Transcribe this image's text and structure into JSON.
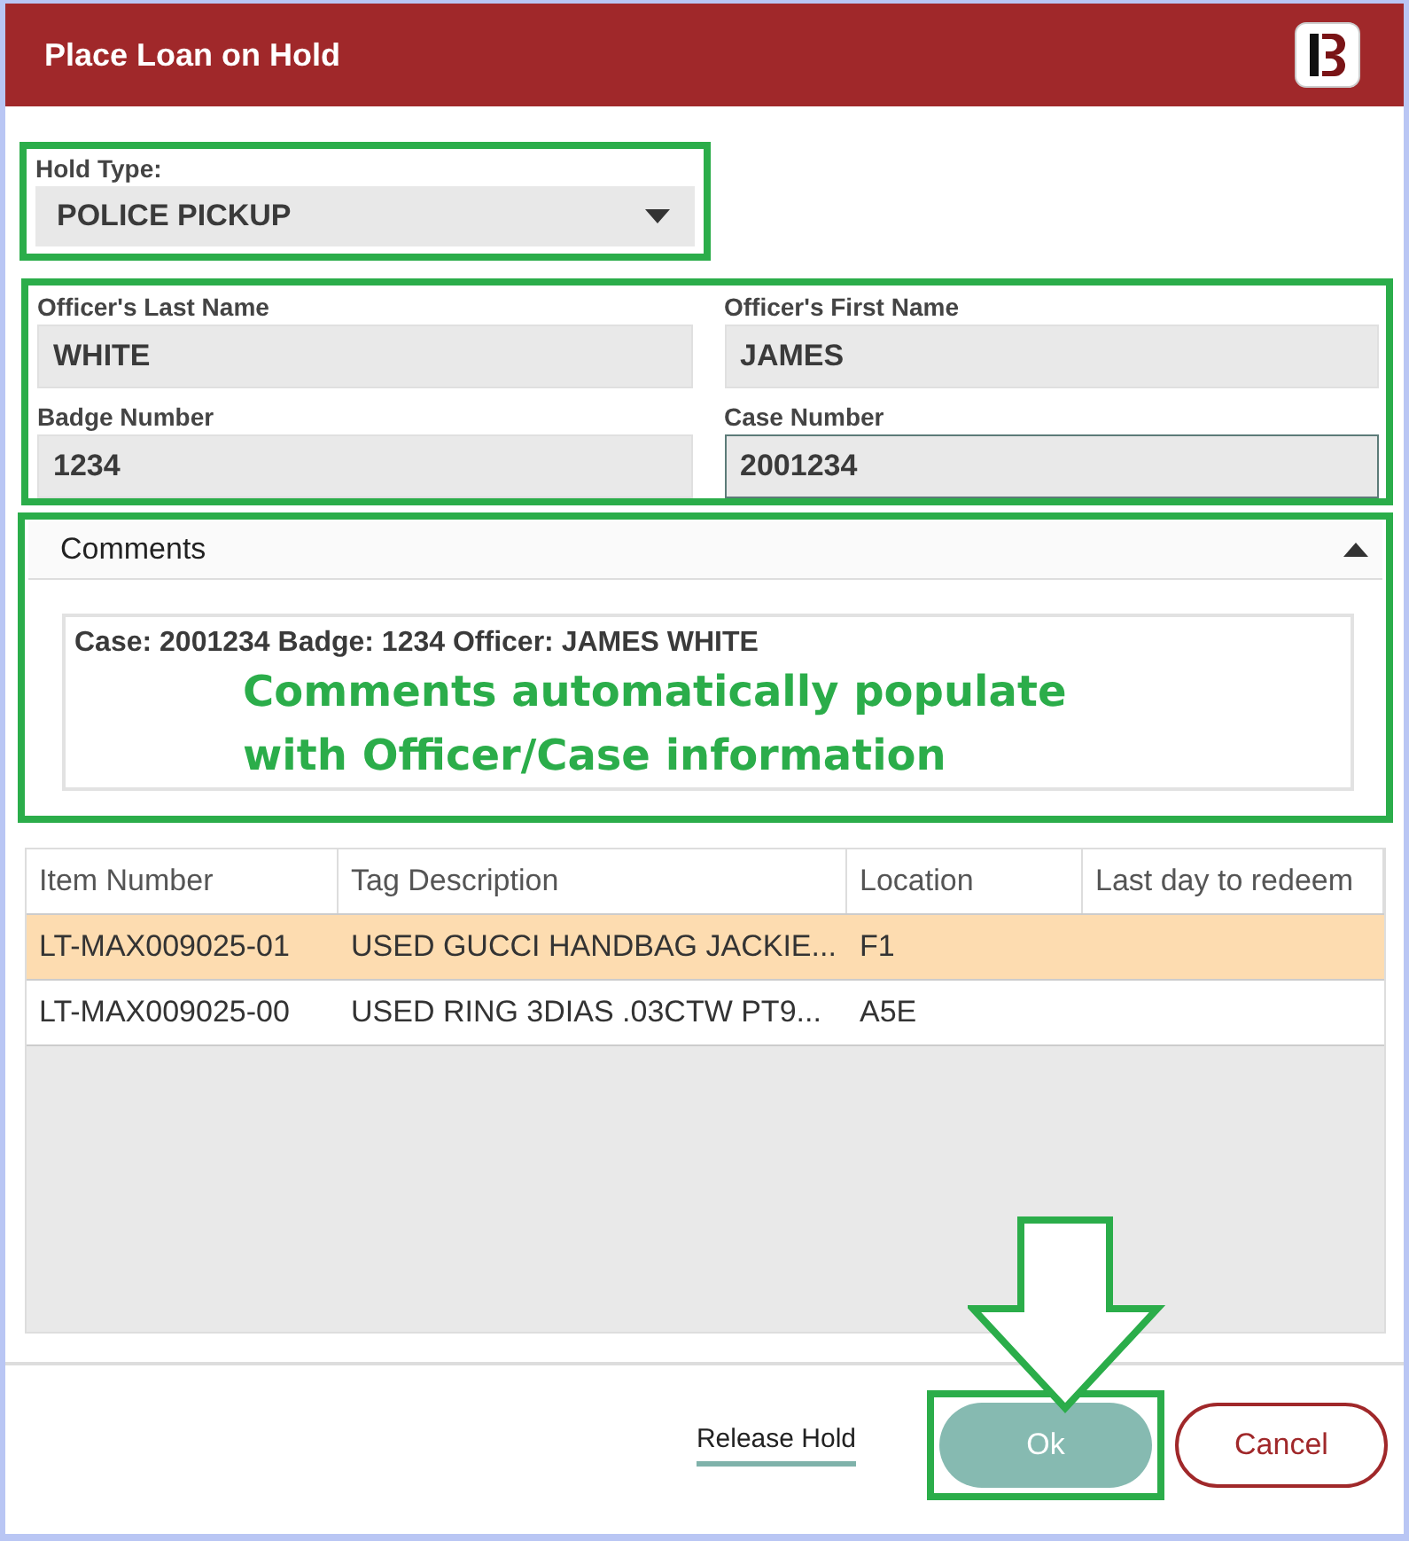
{
  "window": {
    "title": "Place Loan on Hold"
  },
  "hold_type": {
    "label": "Hold Type:",
    "value": "POLICE PICKUP"
  },
  "officer_fields": [
    {
      "label": "Officer's Last Name",
      "value": "WHITE",
      "focused": false
    },
    {
      "label": "Officer's First Name",
      "value": "JAMES",
      "focused": false
    },
    {
      "label": "Badge Number",
      "value": "1234",
      "focused": false
    },
    {
      "label": "Case Number",
      "value": "2001234",
      "focused": true
    }
  ],
  "comments": {
    "title": "Comments",
    "expanded": true,
    "text": "Case: 2001234 Badge: 1234 Officer: JAMES WHITE"
  },
  "annotation": {
    "lines": [
      "Comments automatically populate",
      "with Officer/Case information"
    ]
  },
  "table": {
    "columns": [
      "Item Number",
      "Tag Description",
      "Location",
      "Last day to redeem"
    ],
    "rows": [
      {
        "cells": [
          "LT-MAX009025-01",
          "USED GUCCI HANDBAG JACKIE...",
          "F1",
          ""
        ],
        "selected": true
      },
      {
        "cells": [
          "LT-MAX009025-00",
          "USED RING 3DIAS .03CTW PT9...",
          "A5E",
          ""
        ],
        "selected": false
      }
    ]
  },
  "footer": {
    "link": "Release Hold",
    "ok": "Ok",
    "cancel": "Cancel"
  }
}
